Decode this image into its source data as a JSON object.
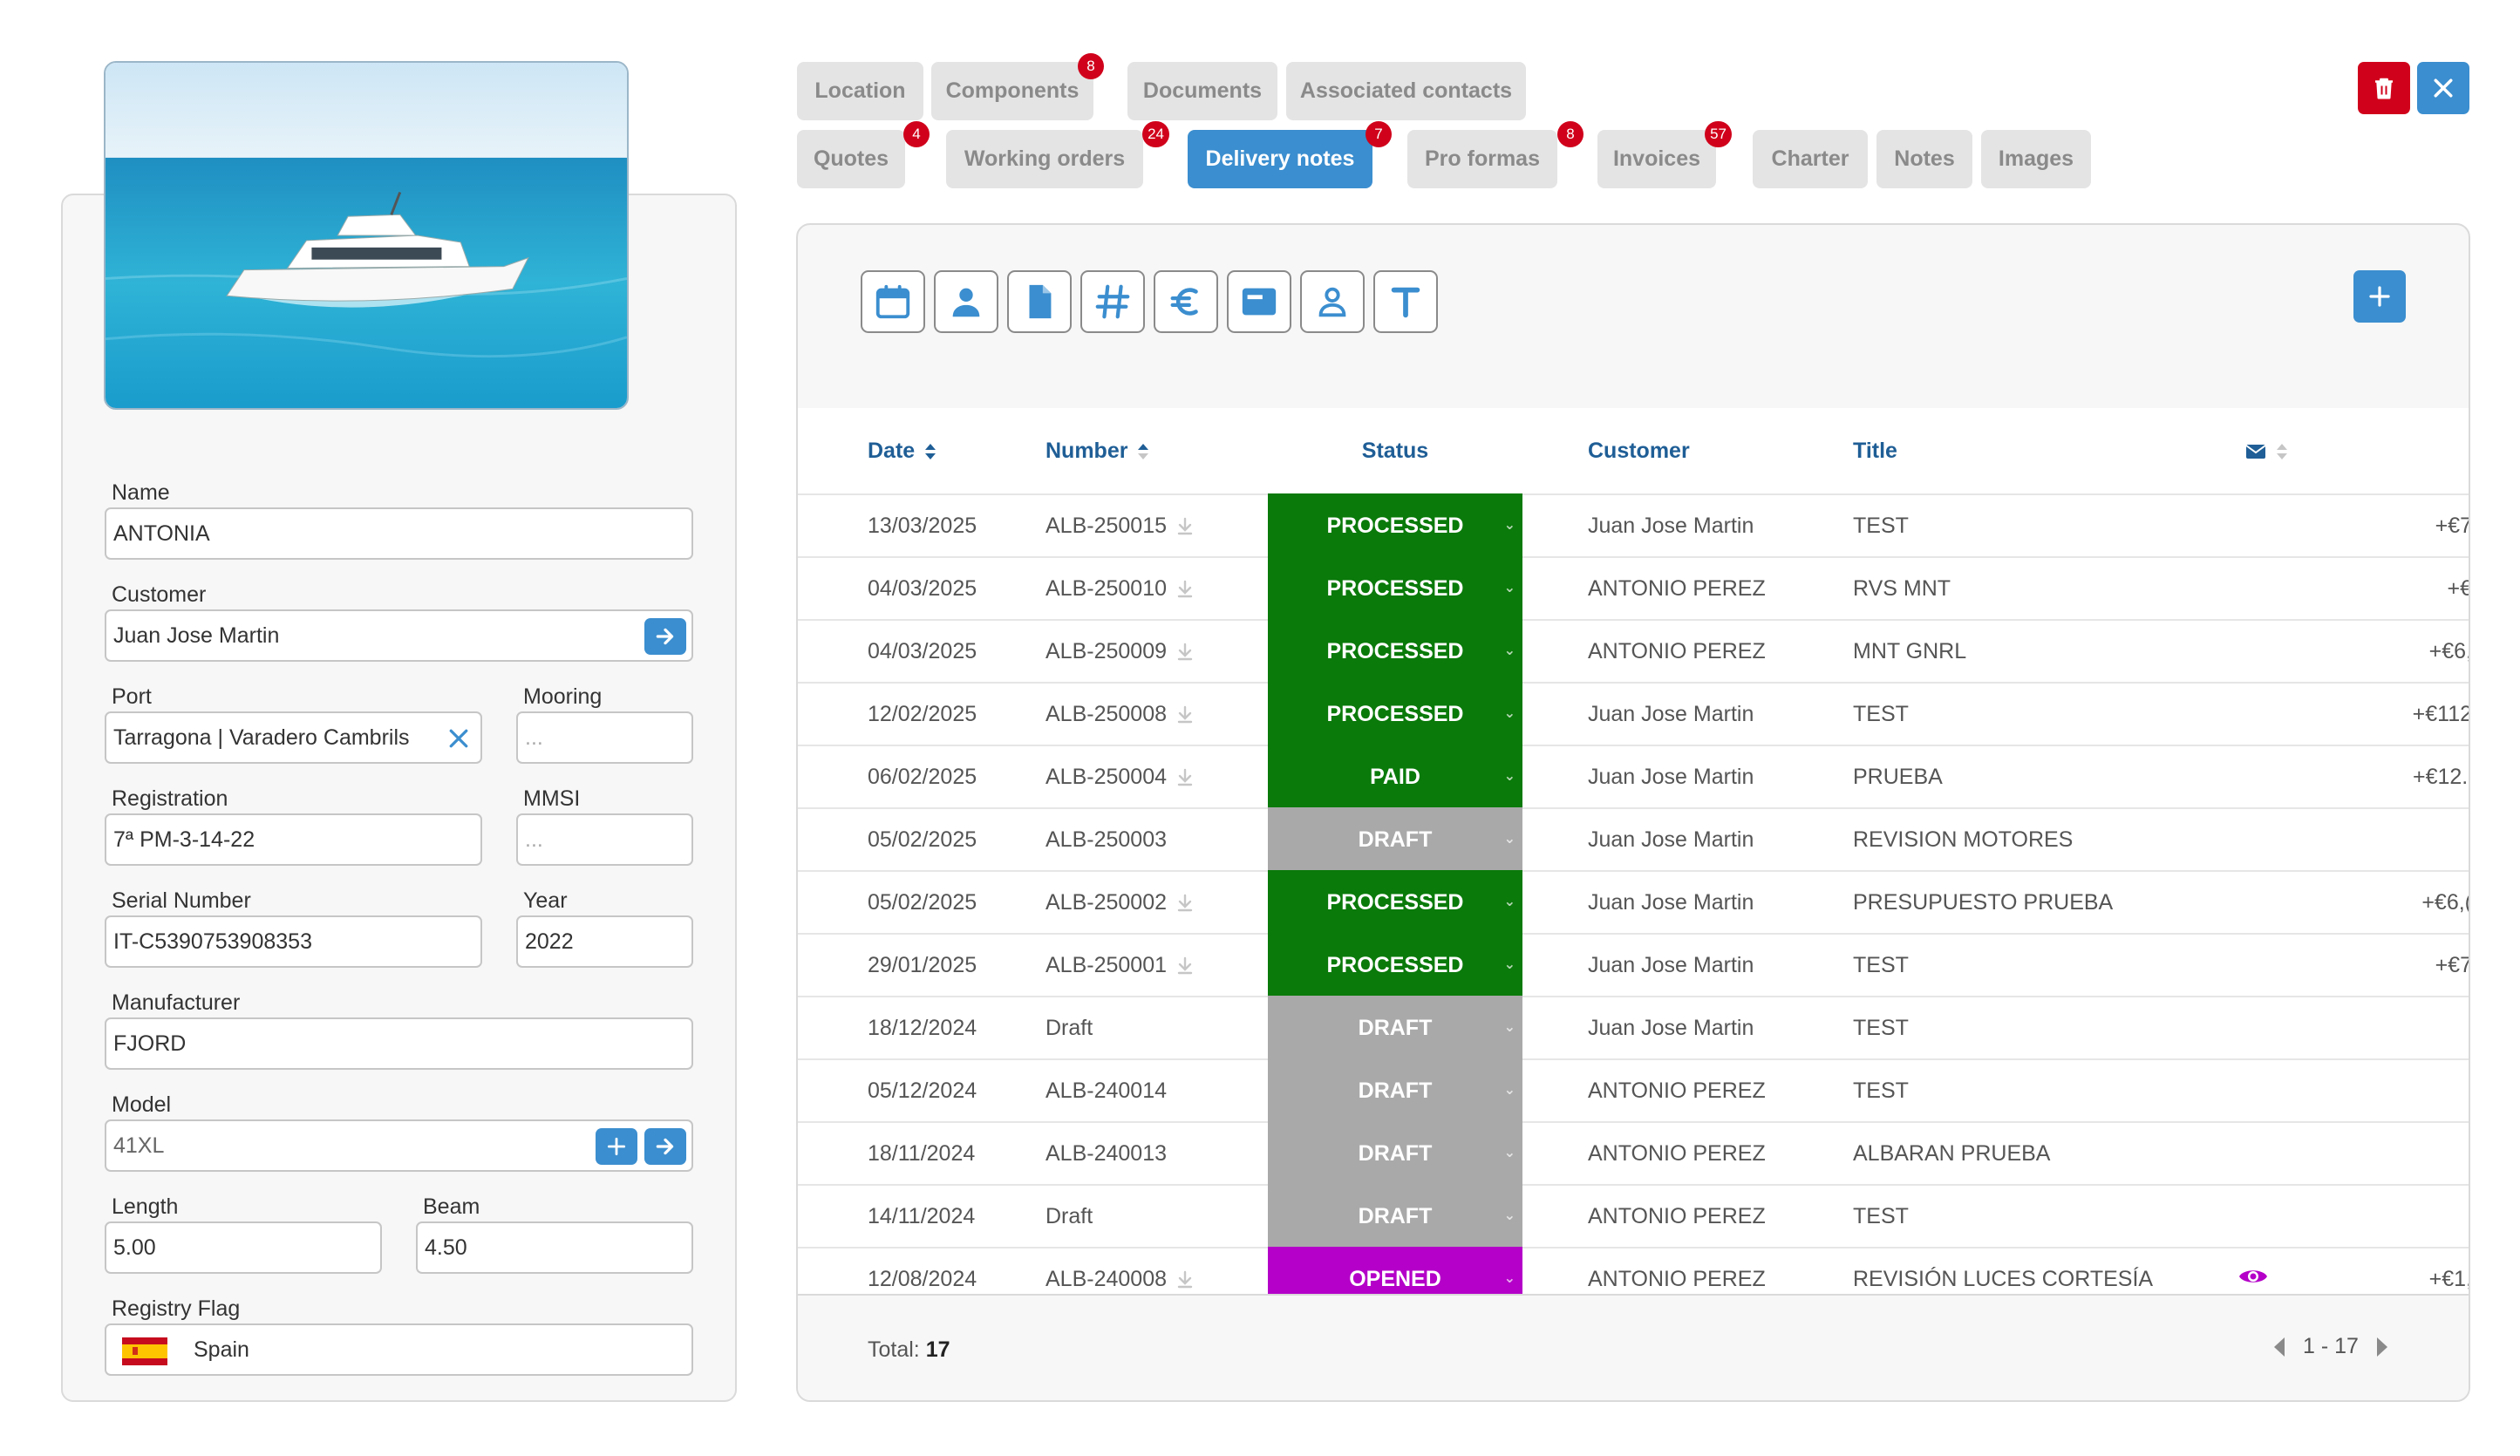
{
  "colors": {
    "accent": "#3b8ecf",
    "processed": "#0a7a0a",
    "paid": "#0a7a0a",
    "draft": "#a9a9a9",
    "opened": "#b400c8",
    "badge": "#d0021b",
    "header_text": "#1f5e96"
  },
  "vessel": {
    "photo_icon": "boat-photo",
    "fields": {
      "name": {
        "label": "Name",
        "value": "ANTONIA"
      },
      "customer": {
        "label": "Customer",
        "value": "Juan Jose Martin"
      },
      "port": {
        "label": "Port",
        "value": "Tarragona | Varadero Cambrils"
      },
      "mooring": {
        "label": "Mooring",
        "placeholder": "..."
      },
      "registration": {
        "label": "Registration",
        "value": "7ª PM-3-14-22"
      },
      "mmsi": {
        "label": "MMSI",
        "placeholder": "..."
      },
      "serial_number": {
        "label": "Serial Number",
        "value": "IT-C5390753908353"
      },
      "year": {
        "label": "Year",
        "value": "2022"
      },
      "manufacturer": {
        "label": "Manufacturer",
        "value": "FJORD"
      },
      "model": {
        "label": "Model",
        "value": "41XL"
      },
      "length": {
        "label": "Length",
        "value": "5.00"
      },
      "beam": {
        "label": "Beam",
        "value": "4.50"
      },
      "registry_flag": {
        "label": "Registry Flag",
        "value": "Spain",
        "flag_icon": "spain-flag-icon"
      }
    }
  },
  "tabs": [
    {
      "label": "Location",
      "badge": ""
    },
    {
      "label": "Components",
      "badge": "8"
    },
    {
      "label": "Documents",
      "badge": ""
    },
    {
      "label": "Associated contacts",
      "badge": ""
    },
    {
      "label": "Quotes",
      "badge": "4"
    },
    {
      "label": "Working orders",
      "badge": "24"
    },
    {
      "label": "Delivery notes",
      "badge": "7",
      "active": true
    },
    {
      "label": "Pro formas",
      "badge": "8"
    },
    {
      "label": "Invoices",
      "badge": "57"
    },
    {
      "label": "Charter",
      "badge": ""
    },
    {
      "label": "Notes",
      "badge": ""
    },
    {
      "label": "Images",
      "badge": ""
    }
  ],
  "filters": [
    "calendar-icon",
    "person-icon",
    "document-icon",
    "hash-icon",
    "euro-icon",
    "card-icon",
    "contact-icon",
    "text-icon"
  ],
  "table": {
    "headers": {
      "date": "Date",
      "number": "Number",
      "status": "Status",
      "customer": "Customer",
      "title": "Title"
    },
    "rows": [
      {
        "date": "13/03/2025",
        "number": "ALB-250015",
        "download": true,
        "status": "PROCESSED",
        "customer": "Juan Jose Martin",
        "title": "TEST",
        "amount": "+€7"
      },
      {
        "date": "04/03/2025",
        "number": "ALB-250010",
        "download": true,
        "status": "PROCESSED",
        "customer": "ANTONIO PEREZ",
        "title": "RVS MNT",
        "amount": "+€"
      },
      {
        "date": "04/03/2025",
        "number": "ALB-250009",
        "download": true,
        "status": "PROCESSED",
        "customer": "ANTONIO PEREZ",
        "title": "MNT GNRL",
        "amount": "+€6,"
      },
      {
        "date": "12/02/2025",
        "number": "ALB-250008",
        "download": true,
        "status": "PROCESSED",
        "customer": "Juan Jose Martin",
        "title": "TEST",
        "amount": "+€112"
      },
      {
        "date": "06/02/2025",
        "number": "ALB-250004",
        "download": true,
        "status": "PAID",
        "customer": "Juan Jose Martin",
        "title": "PRUEBA",
        "amount": "+€12.'"
      },
      {
        "date": "05/02/2025",
        "number": "ALB-250003",
        "download": false,
        "status": "DRAFT",
        "customer": "Juan Jose Martin",
        "title": "REVISION MOTORES",
        "amount": ""
      },
      {
        "date": "05/02/2025",
        "number": "ALB-250002",
        "download": true,
        "status": "PROCESSED",
        "customer": "Juan Jose Martin",
        "title": "PRESUPUESTO PRUEBA",
        "amount": "+€6,("
      },
      {
        "date": "29/01/2025",
        "number": "ALB-250001",
        "download": true,
        "status": "PROCESSED",
        "customer": "Juan Jose Martin",
        "title": "TEST",
        "amount": "+€7"
      },
      {
        "date": "18/12/2024",
        "number": "Draft",
        "download": false,
        "status": "DRAFT",
        "customer": "Juan Jose Martin",
        "title": "TEST",
        "amount": ""
      },
      {
        "date": "05/12/2024",
        "number": "ALB-240014",
        "download": false,
        "status": "DRAFT",
        "customer": "ANTONIO PEREZ",
        "title": "TEST",
        "amount": ""
      },
      {
        "date": "18/11/2024",
        "number": "ALB-240013",
        "download": false,
        "status": "DRAFT",
        "customer": "ANTONIO PEREZ",
        "title": "ALBARAN PRUEBA",
        "amount": ""
      },
      {
        "date": "14/11/2024",
        "number": "Draft",
        "download": false,
        "status": "DRAFT",
        "customer": "ANTONIO PEREZ",
        "title": "TEST",
        "amount": ""
      },
      {
        "date": "12/08/2024",
        "number": "ALB-240008",
        "download": true,
        "status": "OPENED",
        "customer": "ANTONIO PEREZ",
        "title": "REVISIÓN LUCES CORTESÍA",
        "amount": "+€1,",
        "viewed": true
      }
    ]
  },
  "footer": {
    "total_label": "Total:",
    "total_value": "17",
    "range": "1 - 17"
  }
}
